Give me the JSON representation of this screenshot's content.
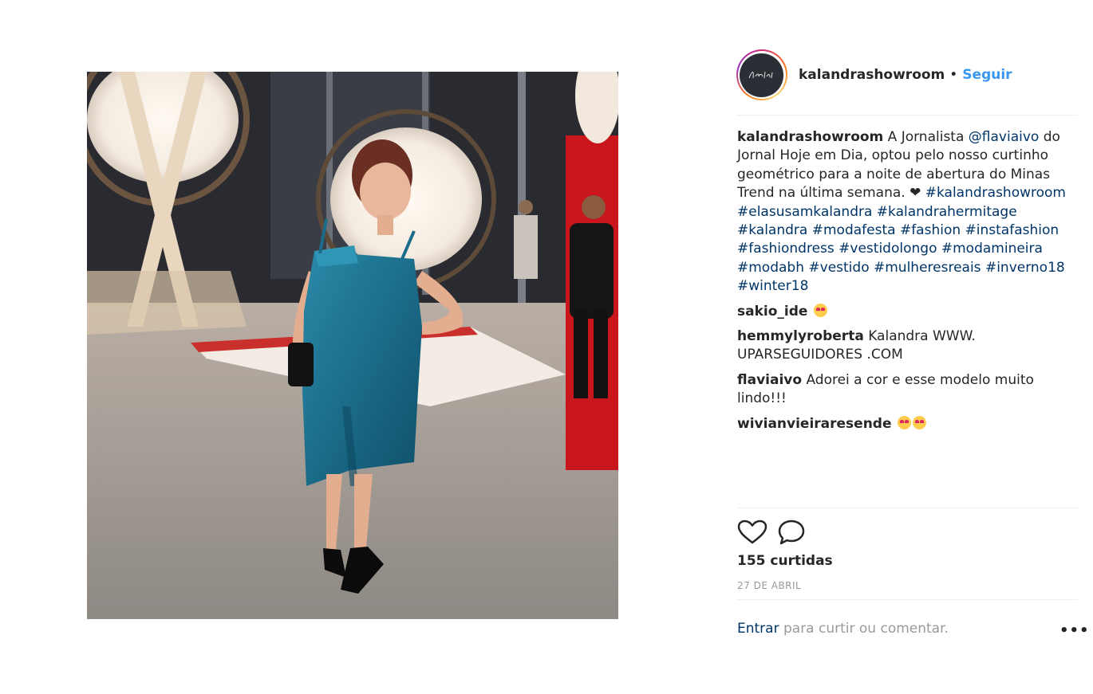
{
  "post": {
    "username": "kalandrashowroom",
    "follow_label": "Seguir",
    "separator": "•",
    "avatar_icon": "kalandra-logo-avatar",
    "photo_subject": "woman-in-blue-dress-photo"
  },
  "caption": {
    "username": "kalandrashowroom",
    "text_before_mention": " A Jornalista ",
    "mention": "@flaviaivo",
    "text_after_mention": " do Jornal Hoje em Dia, optou pelo nosso curtinho geométrico para a noite de abertura do Minas Trend na última semana. ❤",
    "hashtags": [
      "#kalandrashowroom",
      "#elasusamkalandra",
      "#kalandrahermitage",
      "#kalandra",
      "#modafesta",
      "#fashion",
      "#instafashion",
      "#fashiondress",
      "#vestidolongo",
      "#modamineira",
      "#modabh",
      "#vestido",
      "#mulheresreais",
      "#inverno18",
      "#winter18"
    ]
  },
  "comments": [
    {
      "username": "sakio_ide",
      "text": "",
      "emoji_count": 1
    },
    {
      "username": "hemmylyroberta",
      "text": " Kalandra WWW. UPARSEGUIDORES .COM",
      "emoji_count": 0
    },
    {
      "username": "flaviaivo",
      "text": " Adorei a cor e esse modelo muito lindo!!!",
      "emoji_count": 0
    },
    {
      "username": "wivianvieiraresende",
      "text": "",
      "emoji_count": 2
    }
  ],
  "actions": {
    "like_icon": "heart-icon",
    "comment_icon": "comment-icon"
  },
  "likes_text": "155 curtidas",
  "date_text": "27 DE ABRIL",
  "login": {
    "enter_label": "Entrar",
    "rest_text": " para curtir ou comentar."
  },
  "more_label": "•••",
  "colors": {
    "link_blue": "#003569",
    "follow_blue": "#3897f0",
    "muted_gray": "#999999",
    "dress_teal": "#1d6f8c"
  }
}
